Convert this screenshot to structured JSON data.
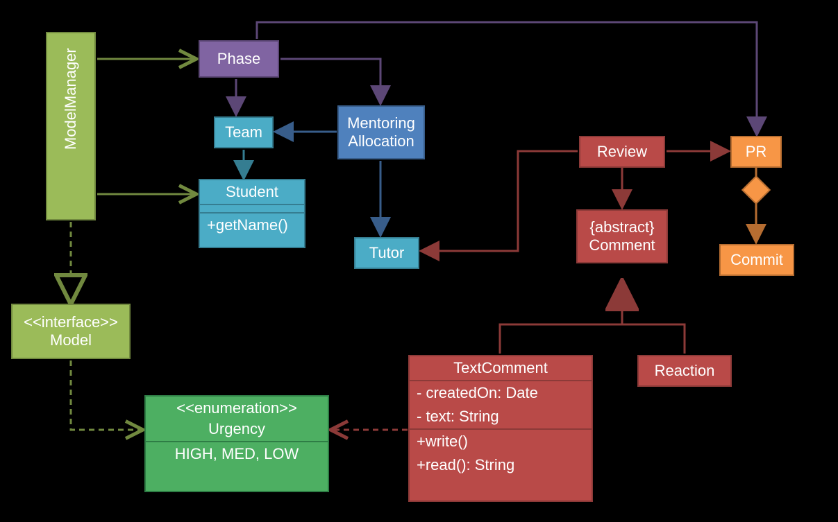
{
  "nodes": {
    "modelmanager": "ModelManager",
    "phase": "Phase",
    "team": "Team",
    "student_name": "Student",
    "student_method": "+getName()",
    "mentoring1": "Mentoring",
    "mentoring2": "Allocation",
    "tutor": "Tutor",
    "model_stereo": "<<interface>>",
    "model_name": "Model",
    "urgency_stereo": "<<enumeration>>",
    "urgency_name": "Urgency",
    "urgency_values": "HIGH, MED, LOW",
    "review": "Review",
    "comment1": "{abstract}",
    "comment2": "Comment",
    "textcomment_name": "TextComment",
    "textcomment_attr1": "- createdOn: Date",
    "textcomment_attr2": "- text: String",
    "textcomment_m1": "+write()",
    "textcomment_m2": "+read(): String",
    "reaction": "Reaction",
    "pr": "PR",
    "commit": "Commit"
  },
  "colors": {
    "olive_fill": "#9BBB59",
    "olive_stroke": "#71893F",
    "green_fill": "#4DAF62",
    "green_stroke": "#2E7D45",
    "purple_fill": "#8064A2",
    "purple_stroke": "#5C4776",
    "teal_fill": "#4BACC6",
    "teal_stroke": "#357D91",
    "blue_fill": "#4F81BD",
    "blue_stroke": "#385D8A",
    "red_fill": "#B94A48",
    "red_stroke": "#8C3A38",
    "orange_fill": "#F79646",
    "orange_stroke": "#B66D31"
  },
  "chart_data": {
    "type": "uml-class-diagram",
    "classes": [
      {
        "name": "ModelManager",
        "stereotype": null
      },
      {
        "name": "Model",
        "stereotype": "interface"
      },
      {
        "name": "Urgency",
        "stereotype": "enumeration",
        "literals": [
          "HIGH",
          "MED",
          "LOW"
        ]
      },
      {
        "name": "Phase"
      },
      {
        "name": "Team"
      },
      {
        "name": "Student",
        "operations": [
          "+getName()"
        ]
      },
      {
        "name": "Mentoring Allocation"
      },
      {
        "name": "Tutor"
      },
      {
        "name": "Review"
      },
      {
        "name": "Comment",
        "abstract": true
      },
      {
        "name": "TextComment",
        "attributes": [
          "- createdOn: Date",
          "- text: String"
        ],
        "operations": [
          "+write()",
          "+read(): String"
        ]
      },
      {
        "name": "Reaction"
      },
      {
        "name": "PR"
      },
      {
        "name": "Commit"
      }
    ],
    "relationships": [
      {
        "from": "ModelManager",
        "to": "Phase",
        "type": "association",
        "arrow": "open"
      },
      {
        "from": "ModelManager",
        "to": "Student",
        "type": "association",
        "arrow": "open"
      },
      {
        "from": "ModelManager",
        "to": "Model",
        "type": "realization",
        "arrow": "hollow",
        "dashed": true
      },
      {
        "from": "Model",
        "to": "Urgency",
        "type": "dependency",
        "arrow": "open",
        "dashed": true
      },
      {
        "from": "Phase",
        "to": "Team",
        "type": "association",
        "arrow": "solid"
      },
      {
        "from": "Phase",
        "to": "Mentoring Allocation",
        "type": "association",
        "arrow": "solid"
      },
      {
        "from": "Phase",
        "to": "PR",
        "type": "association",
        "arrow": "solid"
      },
      {
        "from": "Mentoring Allocation",
        "to": "Team",
        "type": "association",
        "arrow": "solid"
      },
      {
        "from": "Mentoring Allocation",
        "to": "Tutor",
        "type": "association",
        "arrow": "solid"
      },
      {
        "from": "Team",
        "to": "Student",
        "type": "association",
        "arrow": "solid"
      },
      {
        "from": "Review",
        "to": "Tutor",
        "type": "association",
        "arrow": "solid"
      },
      {
        "from": "Review",
        "to": "PR",
        "type": "association",
        "arrow": "solid"
      },
      {
        "from": "Review",
        "to": "Comment",
        "type": "association",
        "arrow": "solid"
      },
      {
        "from": "TextComment",
        "to": "Comment",
        "type": "generalization",
        "arrow": "hollow"
      },
      {
        "from": "Reaction",
        "to": "Comment",
        "type": "generalization",
        "arrow": "hollow"
      },
      {
        "from": "TextComment",
        "to": "Urgency",
        "type": "dependency",
        "arrow": "open",
        "dashed": true
      },
      {
        "from": "PR",
        "to": "Commit",
        "type": "aggregation",
        "arrow": "diamond"
      }
    ]
  }
}
